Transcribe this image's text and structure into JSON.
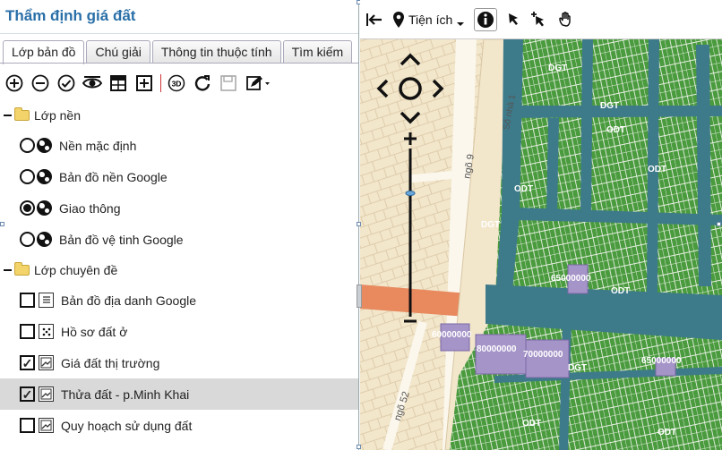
{
  "panel": {
    "title": "Thẩm định giá đất",
    "tabs": [
      {
        "label": "Lớp bản đồ",
        "active": true
      },
      {
        "label": "Chú giải"
      },
      {
        "label": "Thông tin thuộc tính"
      },
      {
        "label": "Tìm kiếm"
      }
    ],
    "toolbar_icons": [
      "add-layer-icon",
      "remove-layer-icon",
      "check-icon",
      "eye-icon",
      "table-icon",
      "plus-box-icon",
      "3d-icon",
      "refresh-icon",
      "save-icon",
      "edit-icon"
    ],
    "toolbar_3d_label": "3D",
    "groups": [
      {
        "label": "Lớp nền",
        "items": [
          {
            "label": "Nền mặc định",
            "type": "radio",
            "checked": false
          },
          {
            "label": "Bản đồ nền Google",
            "type": "radio",
            "checked": false
          },
          {
            "label": "Giao thông",
            "type": "radio",
            "checked": true
          },
          {
            "label": "Bản đồ vệ tinh Google",
            "type": "radio",
            "checked": false
          }
        ]
      },
      {
        "label": "Lớp chuyên đề",
        "items": [
          {
            "label": "Bản đồ địa danh Google",
            "type": "checkbox",
            "checked": false
          },
          {
            "label": "Hồ sơ đất ở",
            "type": "checkbox",
            "checked": false
          },
          {
            "label": "Giá đất thị trường",
            "type": "checkbox",
            "checked": true
          },
          {
            "label": "Thửa đất - p.Minh Khai",
            "type": "checkbox",
            "checked": true,
            "selected": true
          },
          {
            "label": "Quy hoạch sử dụng đất",
            "type": "checkbox",
            "checked": false
          }
        ]
      }
    ]
  },
  "map": {
    "toolbar": {
      "utilities_label": "Tiện ích"
    },
    "street_labels": [
      "ngõ 9",
      "Số nhà 1",
      "ngõ 52"
    ],
    "parcel_labels": [
      "DGT",
      "DGT",
      "ODT",
      "ODT",
      "ODT",
      "DGT",
      "ODT",
      "DGT",
      "ODT",
      "ODT"
    ],
    "price_labels": [
      "65000000",
      "60000000",
      "80000000",
      "70000000",
      "65000000"
    ],
    "colors": {
      "parcel": "#4a9a3e",
      "water": "#3d7a8a",
      "road": "#e8895e",
      "price_parcel": "#a594c8",
      "background": "#f2e6cb"
    }
  }
}
